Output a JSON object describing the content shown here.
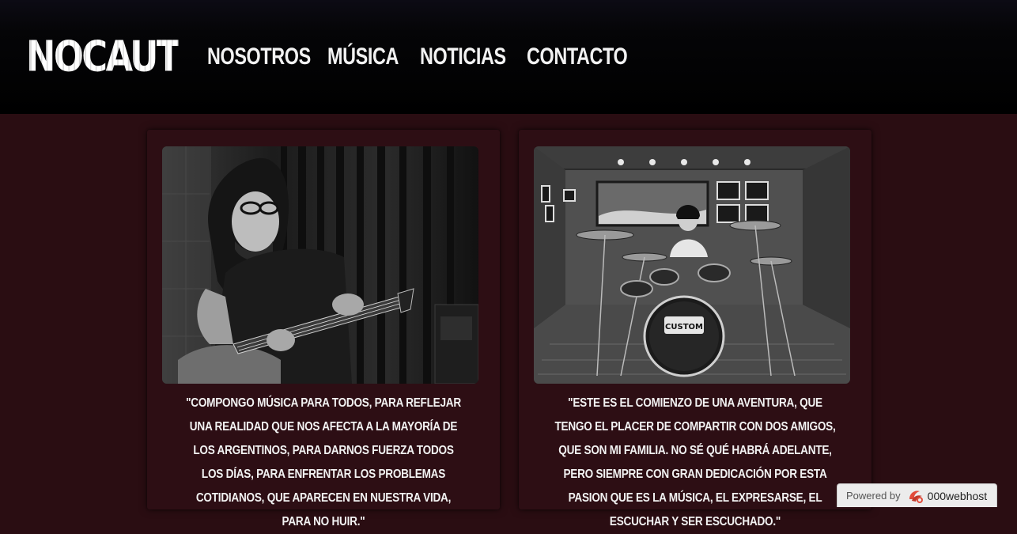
{
  "header": {
    "logo_text": "NOCAUT",
    "nav": [
      "NOSOTROS",
      "MÚSICA",
      "NOTICIAS",
      "CONTACTO"
    ]
  },
  "cards": [
    {
      "photo_subject": "bass-player-photo",
      "quote": "\"Compongo música para todos, para reflejar una realidad que nos afecta a la mayoría de los argentinos, para darnos fuerza todos los días, para enfrentar los problemas cotidianos, que aparecen en nuestra vida, para no huir.\""
    },
    {
      "photo_subject": "drummer-photo",
      "drum_head_text": "CUSTOM",
      "quote": "\"Este es el comienzo de una aventura, que tengo el placer de compartir con dos amigos, que son mi familia. No sé qué habrá adelante, pero siempre con gran dedicación por esta pasion que es la música, el expresarse, el escuchar y ser escuchado.\""
    }
  ],
  "badge": {
    "label": "Powered by",
    "host": "000webhost",
    "icon": "000webhost-logo-icon"
  },
  "colors": {
    "page_bg": "#2a0d12",
    "card_bg": "#2d0e14",
    "header_bg": "#000000",
    "text": "#f2f2f2"
  }
}
